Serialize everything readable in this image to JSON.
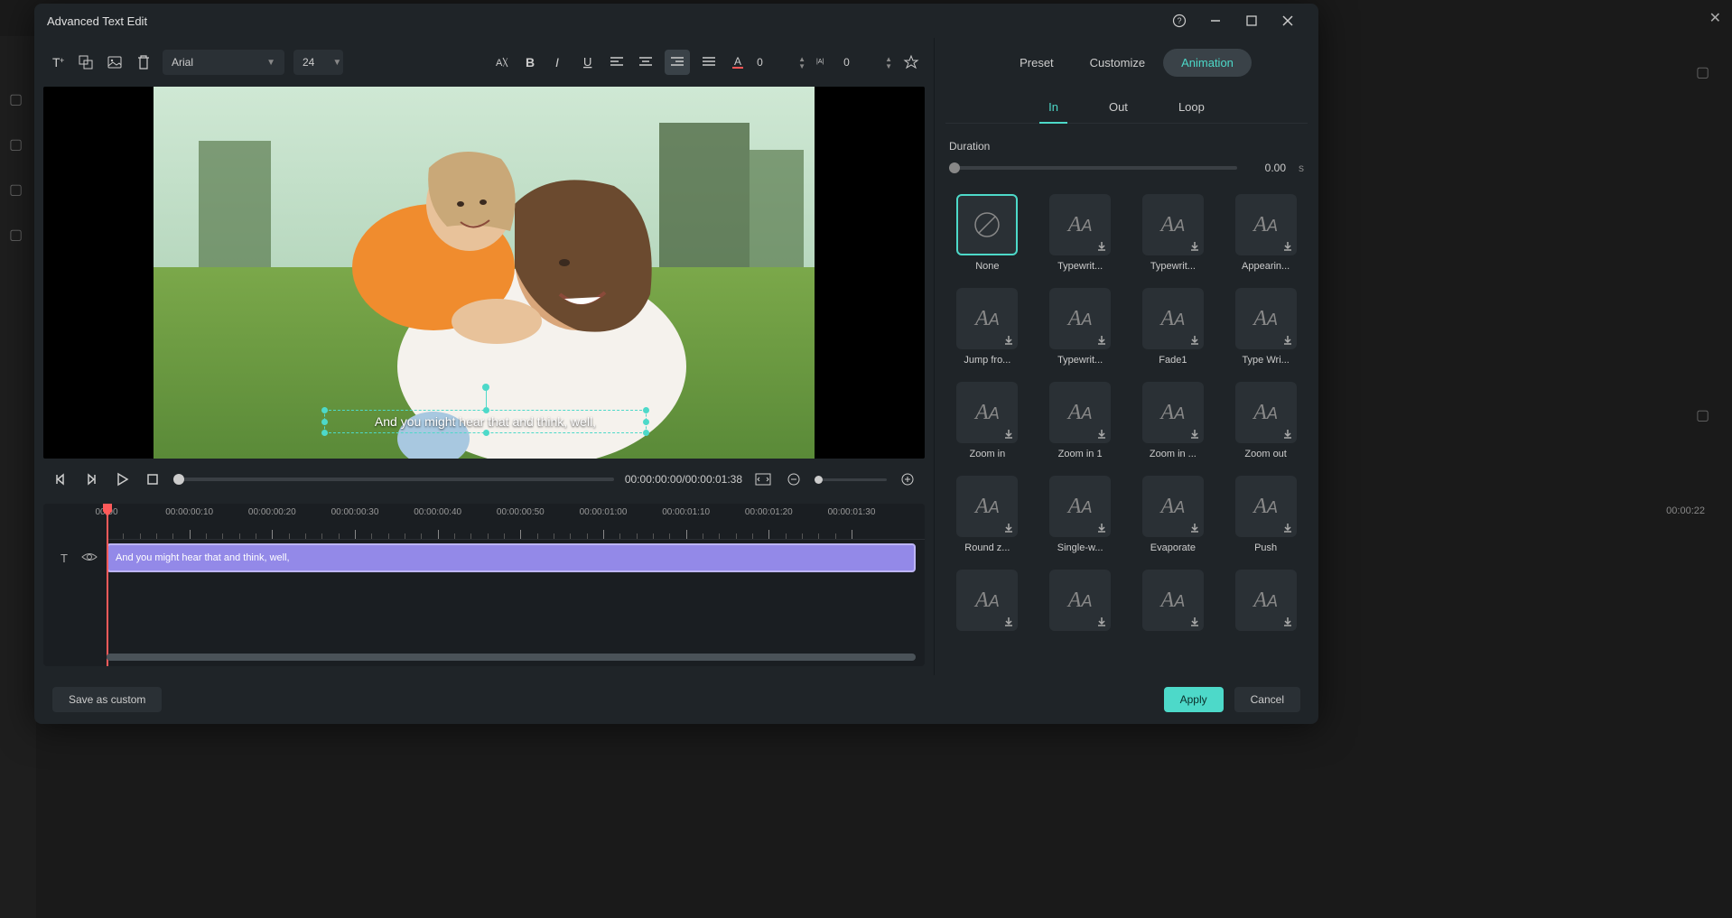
{
  "title": "Advanced Text Edit",
  "toolbar": {
    "font": "Arial",
    "size": "24",
    "char_spacing": "0",
    "line_spacing": "0"
  },
  "playback": {
    "time": "00:00:00:00/00:00:01:38"
  },
  "subtitle_text": "And you might hear that and think, well,",
  "clip_text": "And you might hear that and think, well,",
  "ruler_labels": [
    "00:00",
    "00:00:00:10",
    "00:00:00:20",
    "00:00:00:30",
    "00:00:00:40",
    "00:00:00:50",
    "00:00:01:00",
    "00:00:01:10",
    "00:00:01:20",
    "00:00:01:30"
  ],
  "right_panel": {
    "tabs": [
      "Preset",
      "Customize",
      "Animation"
    ],
    "subtabs": [
      "In",
      "Out",
      "Loop"
    ],
    "duration_label": "Duration",
    "duration_value": "0.00",
    "duration_unit": "s"
  },
  "animations": [
    {
      "label": "None",
      "selected": true,
      "icon": "none"
    },
    {
      "label": "Typewrit...",
      "icon": "aa"
    },
    {
      "label": "Typewrit...",
      "icon": "aa"
    },
    {
      "label": "Appearin...",
      "icon": "aa"
    },
    {
      "label": "Jump fro...",
      "icon": "aa"
    },
    {
      "label": "Typewrit...",
      "icon": "aa"
    },
    {
      "label": "Fade1",
      "icon": "aa"
    },
    {
      "label": "Type Wri...",
      "icon": "aa"
    },
    {
      "label": "Zoom in",
      "icon": "aa"
    },
    {
      "label": "Zoom in 1",
      "icon": "aa"
    },
    {
      "label": "Zoom in ...",
      "icon": "aa"
    },
    {
      "label": "Zoom out",
      "icon": "aa"
    },
    {
      "label": "Round z...",
      "icon": "aa"
    },
    {
      "label": "Single-w...",
      "icon": "aa"
    },
    {
      "label": "Evaporate",
      "icon": "aa"
    },
    {
      "label": "Push",
      "icon": "aa"
    },
    {
      "label": "",
      "icon": "aa"
    },
    {
      "label": "",
      "icon": "aa"
    },
    {
      "label": "",
      "icon": "aa"
    },
    {
      "label": "",
      "icon": "aa"
    }
  ],
  "footer": {
    "save_custom": "Save as custom",
    "apply": "Apply",
    "cancel": "Cancel"
  },
  "bg_timeline": "00:00:22"
}
